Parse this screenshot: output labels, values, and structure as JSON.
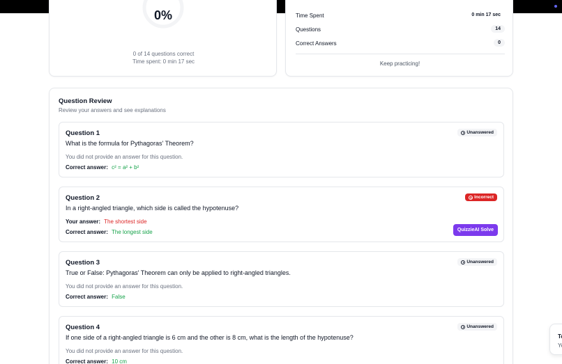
{
  "score": {
    "percent_text": "0%",
    "correct_summary": "0 of 14 questions correct",
    "time_summary": "Time spent: 0 min 17 sec"
  },
  "stats": {
    "rows": [
      {
        "label": "Time Spent",
        "value": "0 min 17 sec"
      },
      {
        "label": "Questions",
        "value": "14"
      },
      {
        "label": "Correct Answers",
        "value": "0"
      }
    ],
    "message": "Keep practicing!"
  },
  "review": {
    "title": "Question Review",
    "subtitle": "Review your answers and see explanations",
    "your_answer_label": "Your answer:",
    "correct_answer_label": "Correct answer:",
    "no_answer_text": "You did not provide an answer for this question.",
    "solve_button_label": "QuizzieAI Solve",
    "questions": [
      {
        "title": "Question 1",
        "text": "What is the formula for Pythagoras' Theorem?",
        "status": "Unanswered",
        "correct_answer": "c² = a² + b²"
      },
      {
        "title": "Question 2",
        "text": "In a right-angled triangle, which side is called the hypotenuse?",
        "status": "Incorrect",
        "your_answer": "The shortest side",
        "correct_answer": "The longest side"
      },
      {
        "title": "Question 3",
        "text": "True or False: Pythagoras' Theorem can only be applied to right-angled triangles.",
        "status": "Unanswered",
        "correct_answer": "False"
      },
      {
        "title": "Question 4",
        "text": "If one side of a right-angled triangle is 6 cm and the other is 8 cm, what is the length of the hypotenuse?",
        "status": "Unanswered",
        "correct_answer": "10 cm"
      }
    ]
  },
  "toast": {
    "line1": "To",
    "line2": "Yo"
  },
  "colors": {
    "correct": "#16a34a",
    "incorrect": "#dc2626",
    "accent": "#7c3aed"
  }
}
